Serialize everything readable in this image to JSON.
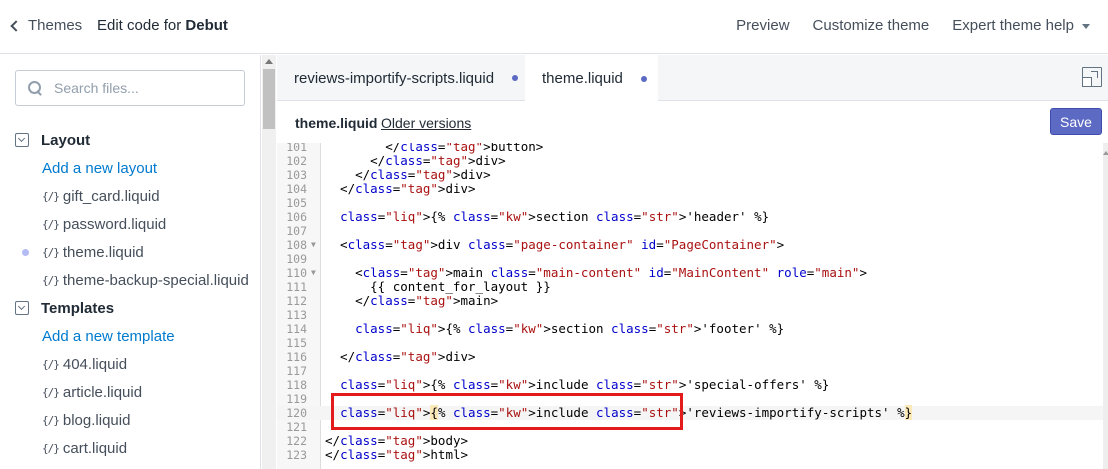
{
  "header": {
    "back_label": "Themes",
    "title_prefix": "Edit code for ",
    "theme_name": "Debut",
    "actions": [
      "Preview",
      "Customize theme",
      "Expert theme help"
    ]
  },
  "sidebar": {
    "search_placeholder": "Search files...",
    "sections": [
      {
        "title": "Layout",
        "add_label": "Add a new layout",
        "items": [
          "gift_card.liquid",
          "password.liquid",
          "theme.liquid",
          "theme-backup-special.liquid"
        ],
        "active_item": "theme.liquid"
      },
      {
        "title": "Templates",
        "add_label": "Add a new template",
        "items": [
          "404.liquid",
          "article.liquid",
          "blog.liquid",
          "cart.liquid"
        ]
      }
    ],
    "liquid_icon": "{/}"
  },
  "tabs": [
    {
      "label": "reviews-importify-scripts.liquid",
      "modified": true
    },
    {
      "label": "theme.liquid",
      "modified": true,
      "active": true
    }
  ],
  "file_bar": {
    "filename": "theme.liquid",
    "older_versions": "Older versions",
    "save_label": "Save"
  },
  "code_lines": [
    {
      "n": "101",
      "text": "        </button>"
    },
    {
      "n": "102",
      "text": "      </div>"
    },
    {
      "n": "103",
      "text": "    </div>"
    },
    {
      "n": "104",
      "text": "  </div>"
    },
    {
      "n": "105",
      "text": ""
    },
    {
      "n": "106",
      "text": "  {% section 'header' %}"
    },
    {
      "n": "107",
      "text": ""
    },
    {
      "n": "108",
      "text": "  <div class=\"page-container\" id=\"PageContainer\">",
      "fold": true
    },
    {
      "n": "109",
      "text": ""
    },
    {
      "n": "110",
      "text": "    <main class=\"main-content\" id=\"MainContent\" role=\"main\">",
      "fold": true
    },
    {
      "n": "111",
      "text": "      {{ content_for_layout }}"
    },
    {
      "n": "112",
      "text": "    </main>"
    },
    {
      "n": "113",
      "text": ""
    },
    {
      "n": "114",
      "text": "    {% section 'footer' %}"
    },
    {
      "n": "115",
      "text": ""
    },
    {
      "n": "116",
      "text": "  </div>"
    },
    {
      "n": "117",
      "text": ""
    },
    {
      "n": "118",
      "text": "  {% include 'special-offers' %}"
    },
    {
      "n": "119",
      "text": ""
    },
    {
      "n": "120",
      "text": "  {% include 'reviews-importify-scripts' %}",
      "active": true
    },
    {
      "n": "121",
      "text": ""
    },
    {
      "n": "122",
      "text": "</body>"
    },
    {
      "n": "123",
      "text": "</html>"
    }
  ],
  "colors": {
    "accent": "#5c6ac4",
    "highlight_box": "#e31b1b",
    "link": "#007ace"
  }
}
